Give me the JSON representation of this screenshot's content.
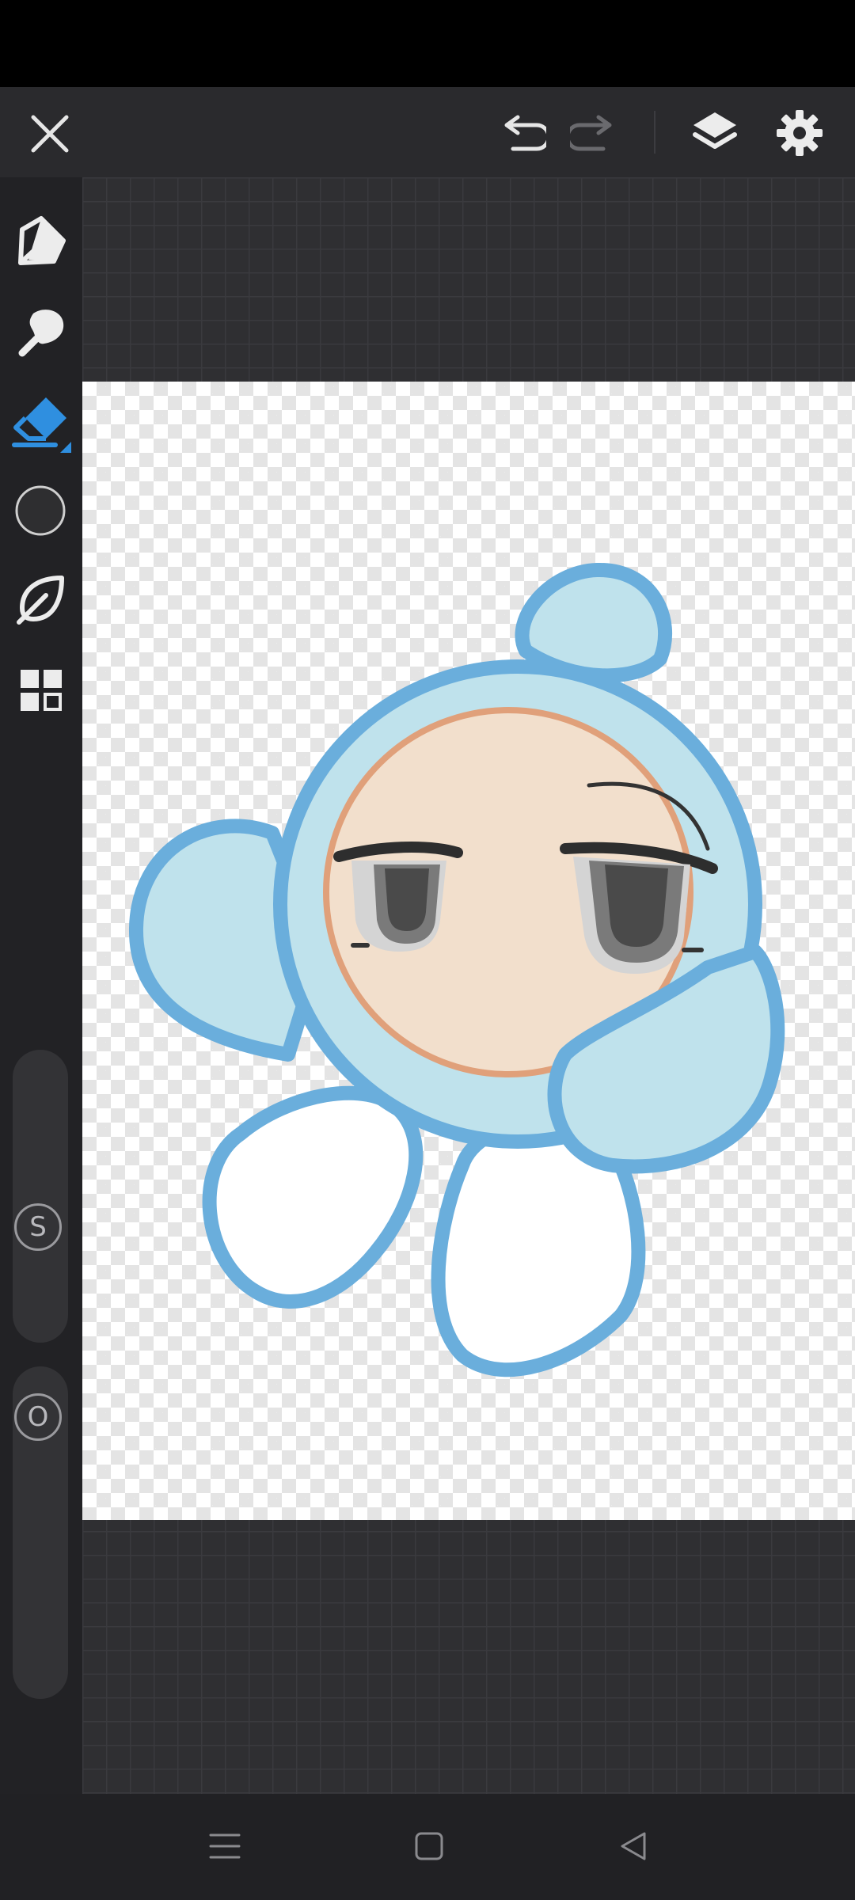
{
  "toolbar": {
    "close": "close-icon",
    "undo": "undo-icon",
    "redo": "redo-icon",
    "layers": "layers-icon",
    "settings": "gear-icon"
  },
  "tools": [
    {
      "name": "pen-tool",
      "icon": "pen-nib-icon",
      "active": false
    },
    {
      "name": "brush-tool",
      "icon": "smudge-brush-icon",
      "active": false
    },
    {
      "name": "eraser-tool",
      "icon": "eraser-icon",
      "active": true
    },
    {
      "name": "color-picker",
      "icon": "color-circle-icon",
      "active": false
    },
    {
      "name": "lasso-tool",
      "icon": "leaf-lasso-icon",
      "active": false
    },
    {
      "name": "more-tools",
      "icon": "grid-icon",
      "active": false
    }
  ],
  "sliders": {
    "size_label": "S",
    "opacity_label": "O"
  },
  "colors": {
    "accent": "#2f8fe0",
    "current_color": "#2e2e30",
    "character_fill": "#bfe2ec",
    "character_outline": "#6aaedc",
    "face": "#f2dfcc"
  },
  "nav": [
    "menu-icon",
    "home-icon",
    "back-icon"
  ]
}
